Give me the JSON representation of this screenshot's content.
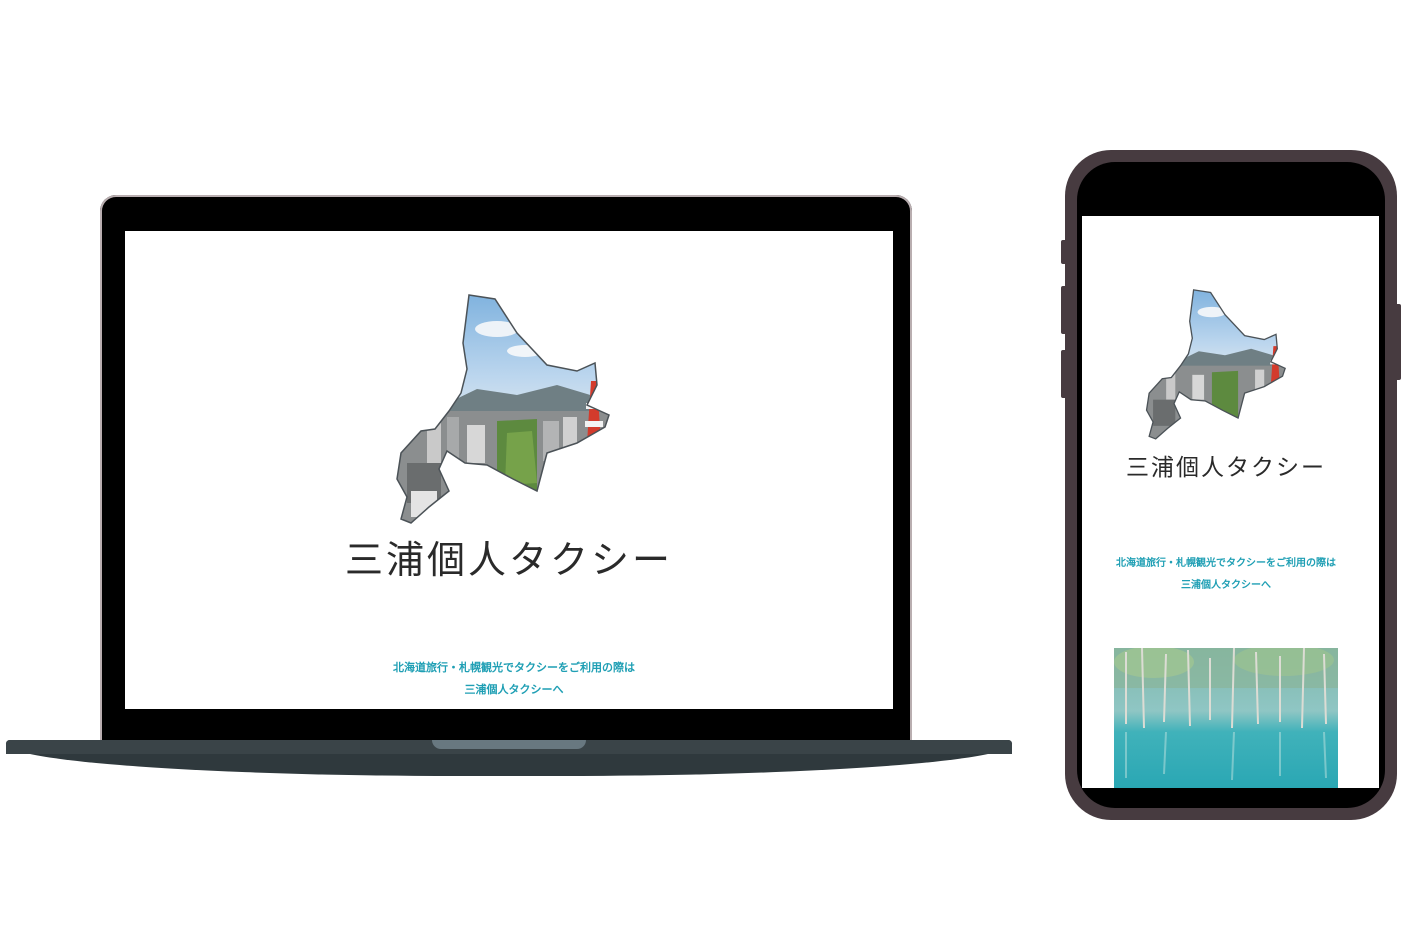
{
  "site": {
    "brand": "三浦個人タクシー",
    "tagline_line1": "北海道旅行・札幌観光でタクシーをご利用の際は",
    "tagline_line2": "三浦個人タクシーへ"
  },
  "images": {
    "hero": "hokkaido-map-city-photo",
    "pond": "blue-pond-photo"
  },
  "colors": {
    "tagline": "#1f9fb4",
    "laptop_base": "#2f393d",
    "phone_frame": "#473b40"
  }
}
